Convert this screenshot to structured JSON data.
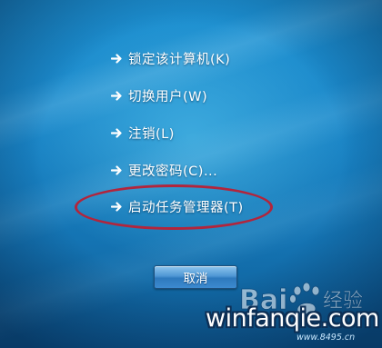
{
  "menu": {
    "items": [
      {
        "label": "锁定该计算机(K)"
      },
      {
        "label": "切换用户(W)"
      },
      {
        "label": "注销(L)"
      },
      {
        "label": "更改密码(C)..."
      },
      {
        "label": "启动任务管理器(T)"
      }
    ],
    "highlighted_index": 4
  },
  "cancel_button": {
    "label": "取消"
  },
  "watermark": {
    "site_text": "winfanqie.com",
    "url_text": "www.8495.cn"
  },
  "colors": {
    "background": "#1a86c8",
    "highlight_oval": "#b2253c",
    "arrow": "#ffffff"
  }
}
